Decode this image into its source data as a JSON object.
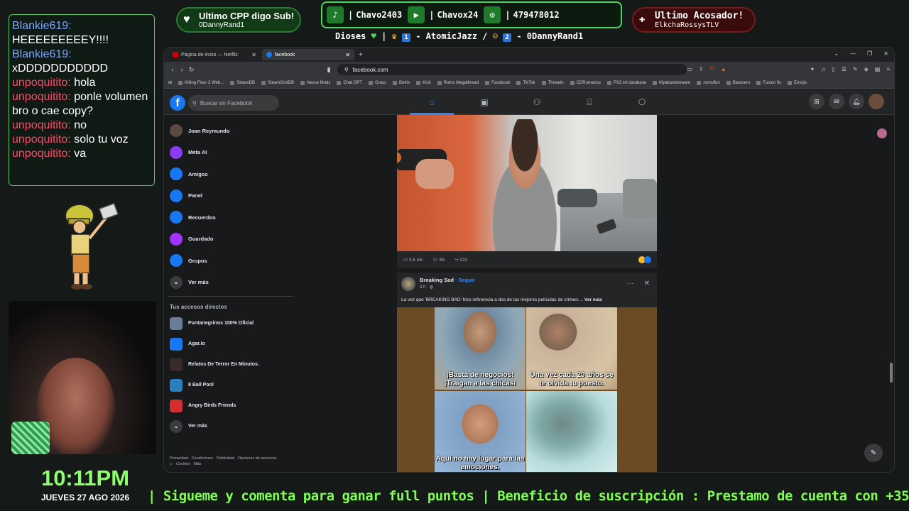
{
  "chat": {
    "messages": [
      {
        "user": "Blankie619:",
        "text": "HEEEEEEEEEY!!!!",
        "color": "#7ea7ff"
      },
      {
        "user": "Blankie619:",
        "text": "xDDDDDDDDDDD",
        "color": "#7ea7ff"
      },
      {
        "user": "unpoquitito:",
        "text": "hola",
        "color": "#ff4b68"
      },
      {
        "user": "unpoquitito:",
        "text": "ponle volumen bro o cae copy?",
        "color": "#ff4b68"
      },
      {
        "user": "unpoquitito:",
        "text": "no",
        "color": "#ff4b68"
      },
      {
        "user": "unpoquitito:",
        "text": "solo tu voz",
        "color": "#ff4b68"
      },
      {
        "user": "unpoquitito:",
        "text": "va",
        "color": "#ff4b68"
      }
    ]
  },
  "overlay": {
    "sub": {
      "title": "Ultimo CPP digo Sub!",
      "name": "0DannyRand1"
    },
    "social": {
      "tiktok": "Chavo2403",
      "youtube": "Chavox24",
      "steam": "479478012"
    },
    "dioses": {
      "label": "Dioses",
      "first": "- AtomicJazz /",
      "second": "- 0DannyRand1",
      "rank1": "1",
      "rank2": "2"
    },
    "acosador": {
      "title": "Ultimo Acosador!",
      "name": "ElkchaRossysTLV"
    },
    "clock": "10:11PM",
    "date": "JUEVES 27 AGO 2026",
    "ticker": "| Sigueme y comenta para ganar full puntos |  Beneficio de suscripción : Prestamo de cuenta con +350 juegos al"
  },
  "browser": {
    "tabs": [
      {
        "label": "Página de inicio — Netflix",
        "active": false
      },
      {
        "label": "facebook",
        "active": true
      }
    ],
    "url": "facebook.com",
    "bookmarks": [
      "Killing Floor 2 Web...",
      "SteamDB",
      "SteamGridDB",
      "Nexus Mods",
      "Chat GPT",
      "Grass",
      "Botrix",
      "Kick",
      "Roms Megathread",
      "Facebook",
      "TikTok",
      "Threads",
      "CDRomance",
      "PS3 ird database",
      "Myabandonware",
      "roms/fun",
      "Baranero",
      "Fusion fix",
      "Emojis"
    ]
  },
  "facebook": {
    "search_placeholder": "Buscar en Facebook",
    "sidebar": [
      {
        "label": "Joan Reymundo",
        "icon": "avatar-icon",
        "color": "#5a4a40"
      },
      {
        "label": "Meta AI",
        "icon": "meta-ai-icon",
        "color": "#8a3cf0"
      },
      {
        "label": "Amigos",
        "icon": "friends-icon",
        "color": "#1877f2"
      },
      {
        "label": "Panel",
        "icon": "panel-icon",
        "color": "#1877f2"
      },
      {
        "label": "Recuerdos",
        "icon": "memories-icon",
        "color": "#1877f2"
      },
      {
        "label": "Guardado",
        "icon": "saved-icon",
        "color": "#a033ff"
      },
      {
        "label": "Grupos",
        "icon": "groups-icon",
        "color": "#1877f2"
      },
      {
        "label": "Ver más",
        "icon": "chevron-down-icon",
        "color": "#3a3b3c"
      }
    ],
    "shortcuts_title": "Tus accesos directos",
    "shortcuts": [
      {
        "label": "Puntanegrinos 100% Oficial",
        "icon": "group-icon",
        "color": "#6a7c96"
      },
      {
        "label": "Agar.io",
        "icon": "agario-icon",
        "color": "#1877f2"
      },
      {
        "label": "Relatos De Terror En Minutos.",
        "icon": "page-icon",
        "color": "#3a2b2b"
      },
      {
        "label": "8 Ball Pool",
        "icon": "pool-icon",
        "color": "#2b7fbf"
      },
      {
        "label": "Angry Birds Friends",
        "icon": "angry-birds-icon",
        "color": "#d32f2f"
      },
      {
        "label": "Ver más",
        "icon": "chevron-down-icon",
        "color": "#3a3b3c"
      }
    ],
    "footer": {
      "line1": "Privacidad · Condiciones · Publicidad · Opciones de anuncios",
      "line2": "▷ · Cookies · Más"
    },
    "post1": {
      "likes": "3,6 mil",
      "comments": "69",
      "shares": "222"
    },
    "post2": {
      "author": "Breaking Sad",
      "follow": "· Seguir",
      "time": "3 h · ",
      "text": "La vez que 'BREAKING BAD' hizo referencia a dos de las mejores películas de crimen.... ",
      "more": "Ver más",
      "captions": [
        "¡Basta de negocios! ¡Traigan a las chicas!",
        "Una vez cada 20 años se te olvida tu puesto.",
        "Aquí no hay lugar para las emociones.",
        ""
      ]
    }
  }
}
